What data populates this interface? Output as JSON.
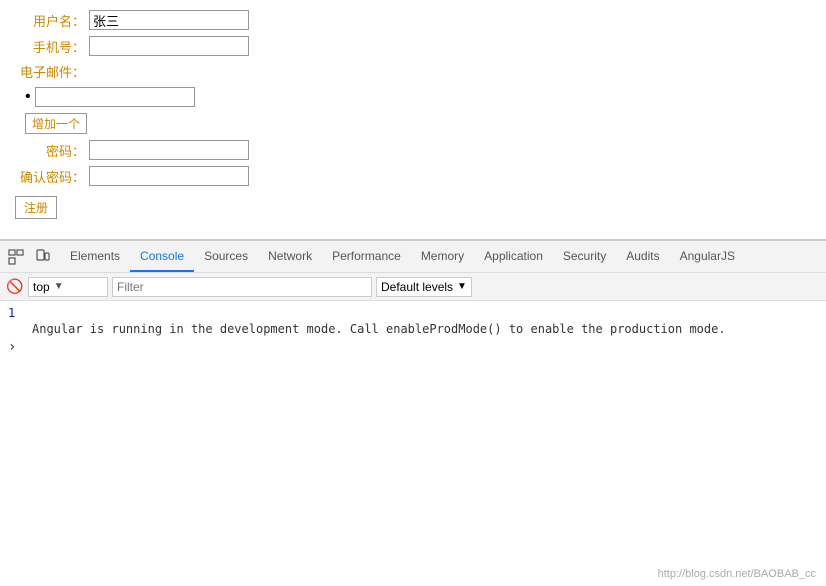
{
  "form": {
    "username_label": "用户名：",
    "username_value": "张三",
    "phone_label": "手机号：",
    "email_label": "电子邮件：",
    "add_button": "增加一个",
    "password_label": "密码：",
    "confirm_label": "确认密码：",
    "register_button": "注册"
  },
  "devtools": {
    "tabs": [
      {
        "label": "Elements",
        "active": false
      },
      {
        "label": "Console",
        "active": true
      },
      {
        "label": "Sources",
        "active": false
      },
      {
        "label": "Network",
        "active": false
      },
      {
        "label": "Performance",
        "active": false
      },
      {
        "label": "Memory",
        "active": false
      },
      {
        "label": "Application",
        "active": false
      },
      {
        "label": "Security",
        "active": false
      },
      {
        "label": "Audits",
        "active": false
      },
      {
        "label": "AngularJS",
        "active": false
      }
    ],
    "console": {
      "context": "top",
      "filter_placeholder": "Filter",
      "default_levels": "Default levels",
      "output_lines": [
        {
          "number": "1",
          "text": ""
        },
        {
          "number": "",
          "text": "Angular is running in the development mode. Call enableProdMode() to enable the production mode."
        }
      ]
    }
  },
  "watermark": "http://blog.csdn.net/BAOBAB_cc"
}
